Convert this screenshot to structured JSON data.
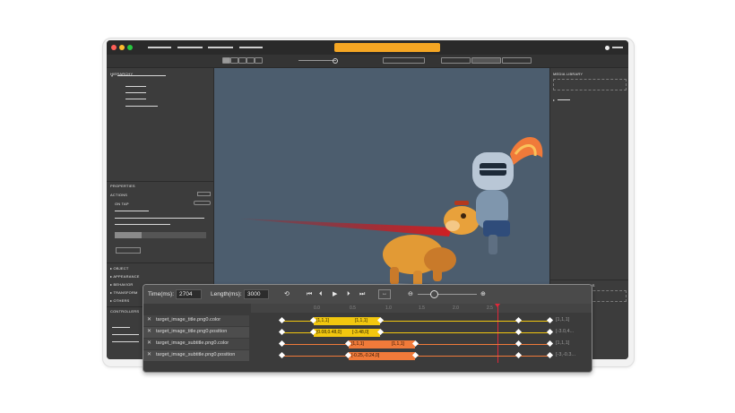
{
  "colors": {
    "accent": "#f5a623",
    "track_yellow": "#f2c70f",
    "track_orange": "#f07a3a",
    "playhead": "#e0283a",
    "viewport_bg": "#4c5d6e"
  },
  "hierarchy": {
    "title": "HIERARCHY"
  },
  "properties": {
    "title": "PROPERTIES",
    "actions_label": "ACTIONS",
    "on_tap_label": "ON TAP",
    "sections": [
      "OBJECT",
      "APPEARANCE",
      "BEHAVIOR",
      "TRANSFORM",
      "OTHERS"
    ]
  },
  "controllers": {
    "title": "CONTROLLERS"
  },
  "media_library": {
    "title": "MEDIA LIBRARY"
  },
  "symbol_definitions": {
    "title": "SYMBOL DEFINITIONS"
  },
  "timeline": {
    "time_label": "Time(ms):",
    "time_value": "2704",
    "length_label": "Length(ms):",
    "length_value": "3000",
    "ruler_ticks": [
      "0.0",
      "0.5",
      "1.0",
      "1.5",
      "2.0",
      "2.5"
    ],
    "playhead_time": 2.7,
    "tracks": [
      {
        "name": "target_image_title.png0.color",
        "segment": [
          "[1,1,1]",
          "[1,1,1]"
        ],
        "end": "[1,1,1]",
        "color": "#f2c70f"
      },
      {
        "name": "target_image_title.png0.position",
        "segment": [
          "[0.08,0.48,0]",
          "[-3.48,0]"
        ],
        "end": "[-3.0,4...",
        "color": "#f2c70f"
      },
      {
        "name": "target_image_subtitle.png0.color",
        "segment": [
          "[1,1,1]",
          "[1,1,1]"
        ],
        "end": "[1,1,1]",
        "color": "#f07a3a"
      },
      {
        "name": "target_image_subtitle.png0.position",
        "segment": [
          "[-0.25,-0.24,0]",
          ""
        ],
        "end": "[-3,-0.3...",
        "color": "#f07a3a"
      }
    ]
  }
}
